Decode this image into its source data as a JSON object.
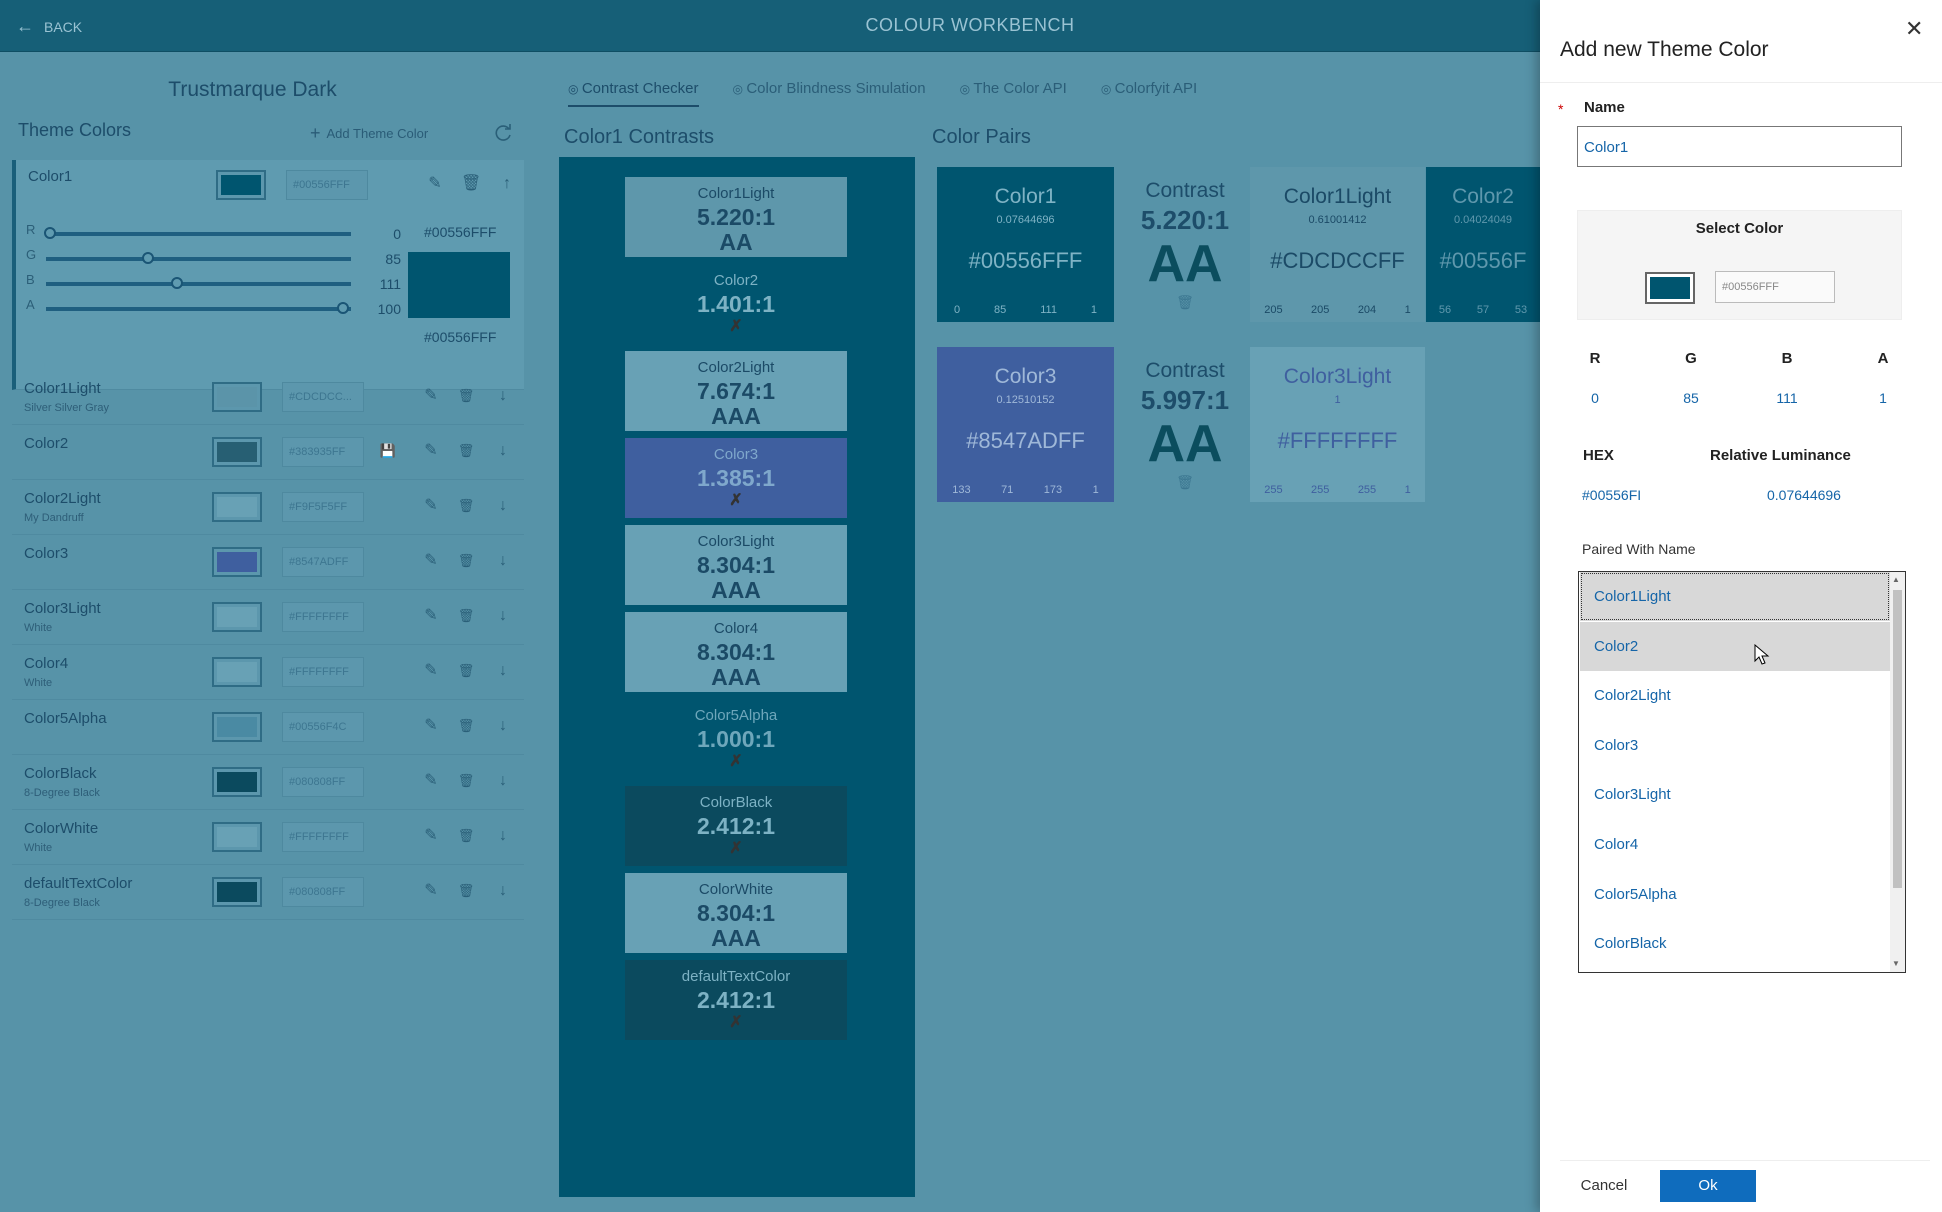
{
  "topbar": {
    "back_label": "BACK",
    "title": "COLOUR WORKBENCH"
  },
  "scheme": {
    "name": "Trustmarque Dark"
  },
  "theme": {
    "header": "Theme Colors",
    "add_label": "Add Theme Color",
    "selected": {
      "name": "Color1",
      "hex": "#00556FFF",
      "r": "0",
      "g": "85",
      "b": "111",
      "a": "100",
      "r_frac": 0,
      "g_frac": 0.333,
      "b_frac": 0.435,
      "a_frac": 1,
      "hex_top": "#00556FFF",
      "hex_bottom": "#00556FFF",
      "color": "#00556f"
    },
    "colors": [
      {
        "name": "Color1Light",
        "sub": "Silver Silver Gray",
        "hex": "#CDCDCC...",
        "color": "#5b94a9"
      },
      {
        "name": "Color2",
        "sub": "",
        "hex": "#383935FF",
        "color": "#275f73"
      },
      {
        "name": "Color2Light",
        "sub": "My Dandruff",
        "hex": "#F9F5F5FF",
        "color": "#68a1b5"
      },
      {
        "name": "Color3",
        "sub": "",
        "hex": "#8547ADFF",
        "color": "#3f5f9f"
      },
      {
        "name": "Color3Light",
        "sub": "White",
        "hex": "#FFFFFFFF",
        "color": "#68a1b5"
      },
      {
        "name": "Color4",
        "sub": "White",
        "hex": "#FFFFFFFF",
        "color": "#68a1b5"
      },
      {
        "name": "Color5Alpha",
        "sub": "",
        "hex": "#00556F4C",
        "color": "#4a8aa3"
      },
      {
        "name": "ColorBlack",
        "sub": "8-Degree Black",
        "hex": "#080808FF",
        "color": "#0b4a5e"
      },
      {
        "name": "ColorWhite",
        "sub": "White",
        "hex": "#FFFFFFFF",
        "color": "#68a1b5"
      },
      {
        "name": "defaultTextColor",
        "sub": "8-Degree Black",
        "hex": "#080808FF",
        "color": "#0b4a5e"
      }
    ]
  },
  "tabs": [
    "Contrast Checker",
    "Color Blindness Simulation",
    "The Color API",
    "Colorfyit API"
  ],
  "contrasts": {
    "header": "Color1 Contrasts",
    "items": [
      {
        "name": "Color1Light",
        "ratio": "5.220:1",
        "level": "AA",
        "bg": "#5e97ab",
        "fg": "#1b4a66"
      },
      {
        "name": "Color2",
        "ratio": "1.401:1",
        "level": "✗",
        "bg": "#00556f",
        "fg": "#7db2c4"
      },
      {
        "name": "Color2Light",
        "ratio": "7.674:1",
        "level": "AAA",
        "bg": "#68a1b5",
        "fg": "#1b4a66"
      },
      {
        "name": "Color3",
        "ratio": "1.385:1",
        "level": "✗",
        "bg": "#3f5f9f",
        "fg": "#7fa8cc"
      },
      {
        "name": "Color3Light",
        "ratio": "8.304:1",
        "level": "AAA",
        "bg": "#68a1b5",
        "fg": "#1b4a66"
      },
      {
        "name": "Color4",
        "ratio": "8.304:1",
        "level": "AAA",
        "bg": "#68a1b5",
        "fg": "#1b4a66"
      },
      {
        "name": "Color5Alpha",
        "ratio": "1.000:1",
        "level": "✗",
        "bg": "#00556f",
        "fg": "#6ea7bb"
      },
      {
        "name": "ColorBlack",
        "ratio": "2.412:1",
        "level": "✗",
        "bg": "#0b4a5e",
        "fg": "#7db2c4"
      },
      {
        "name": "ColorWhite",
        "ratio": "8.304:1",
        "level": "AAA",
        "bg": "#68a1b5",
        "fg": "#1b4a66"
      },
      {
        "name": "defaultTextColor",
        "ratio": "2.412:1",
        "level": "✗",
        "bg": "#0b4a5e",
        "fg": "#7db2c4"
      }
    ]
  },
  "pairs": {
    "header": "Color Pairs",
    "row1": {
      "c1": {
        "name": "Color1",
        "lum": "0.07644696",
        "hex": "#00556FFF",
        "rgba": [
          "0",
          "85",
          "111",
          "1"
        ]
      },
      "contrast": {
        "label": "Contrast",
        "ratio": "5.220:1",
        "level": "AA"
      },
      "c2": {
        "name": "Color1Light",
        "lum": "0.61001412",
        "hex": "#CDCDCCFF",
        "rgba": [
          "205",
          "205",
          "204",
          "1"
        ]
      },
      "c3": {
        "name": "Color2",
        "lum": "0.04024049",
        "hex": "#00556F",
        "rgba": [
          "56",
          "57",
          "53"
        ]
      }
    },
    "row2": {
      "c1": {
        "name": "Color3",
        "lum": "0.12510152",
        "hex": "#8547ADFF",
        "rgba": [
          "133",
          "71",
          "173",
          "1"
        ]
      },
      "contrast": {
        "label": "Contrast",
        "ratio": "5.997:1",
        "level": "AA"
      },
      "c2": {
        "name": "Color3Light",
        "lum": "1",
        "hex": "#FFFFFFFF",
        "rgba": [
          "255",
          "255",
          "255",
          "1"
        ]
      }
    }
  },
  "dialog": {
    "title": "Add new Theme Color",
    "required_mark": "*",
    "name_label": "Name",
    "name_value": "Color1",
    "select_color_label": "Select Color",
    "select_hex": "#00556FFF",
    "rgba_labels": [
      "R",
      "G",
      "B",
      "A"
    ],
    "rgba_values": [
      "0",
      "85",
      "111",
      "1"
    ],
    "hex_label": "HEX",
    "hex_value": "#00556FI",
    "lum_label": "Relative Luminance",
    "lum_value": "0.07644696",
    "paired_label": "Paired With Name",
    "options": [
      "Color1Light",
      "Color2",
      "Color2Light",
      "Color3",
      "Color3Light",
      "Color4",
      "Color5Alpha",
      "ColorBlack"
    ],
    "cancel_label": "Cancel",
    "ok_label": "Ok"
  }
}
